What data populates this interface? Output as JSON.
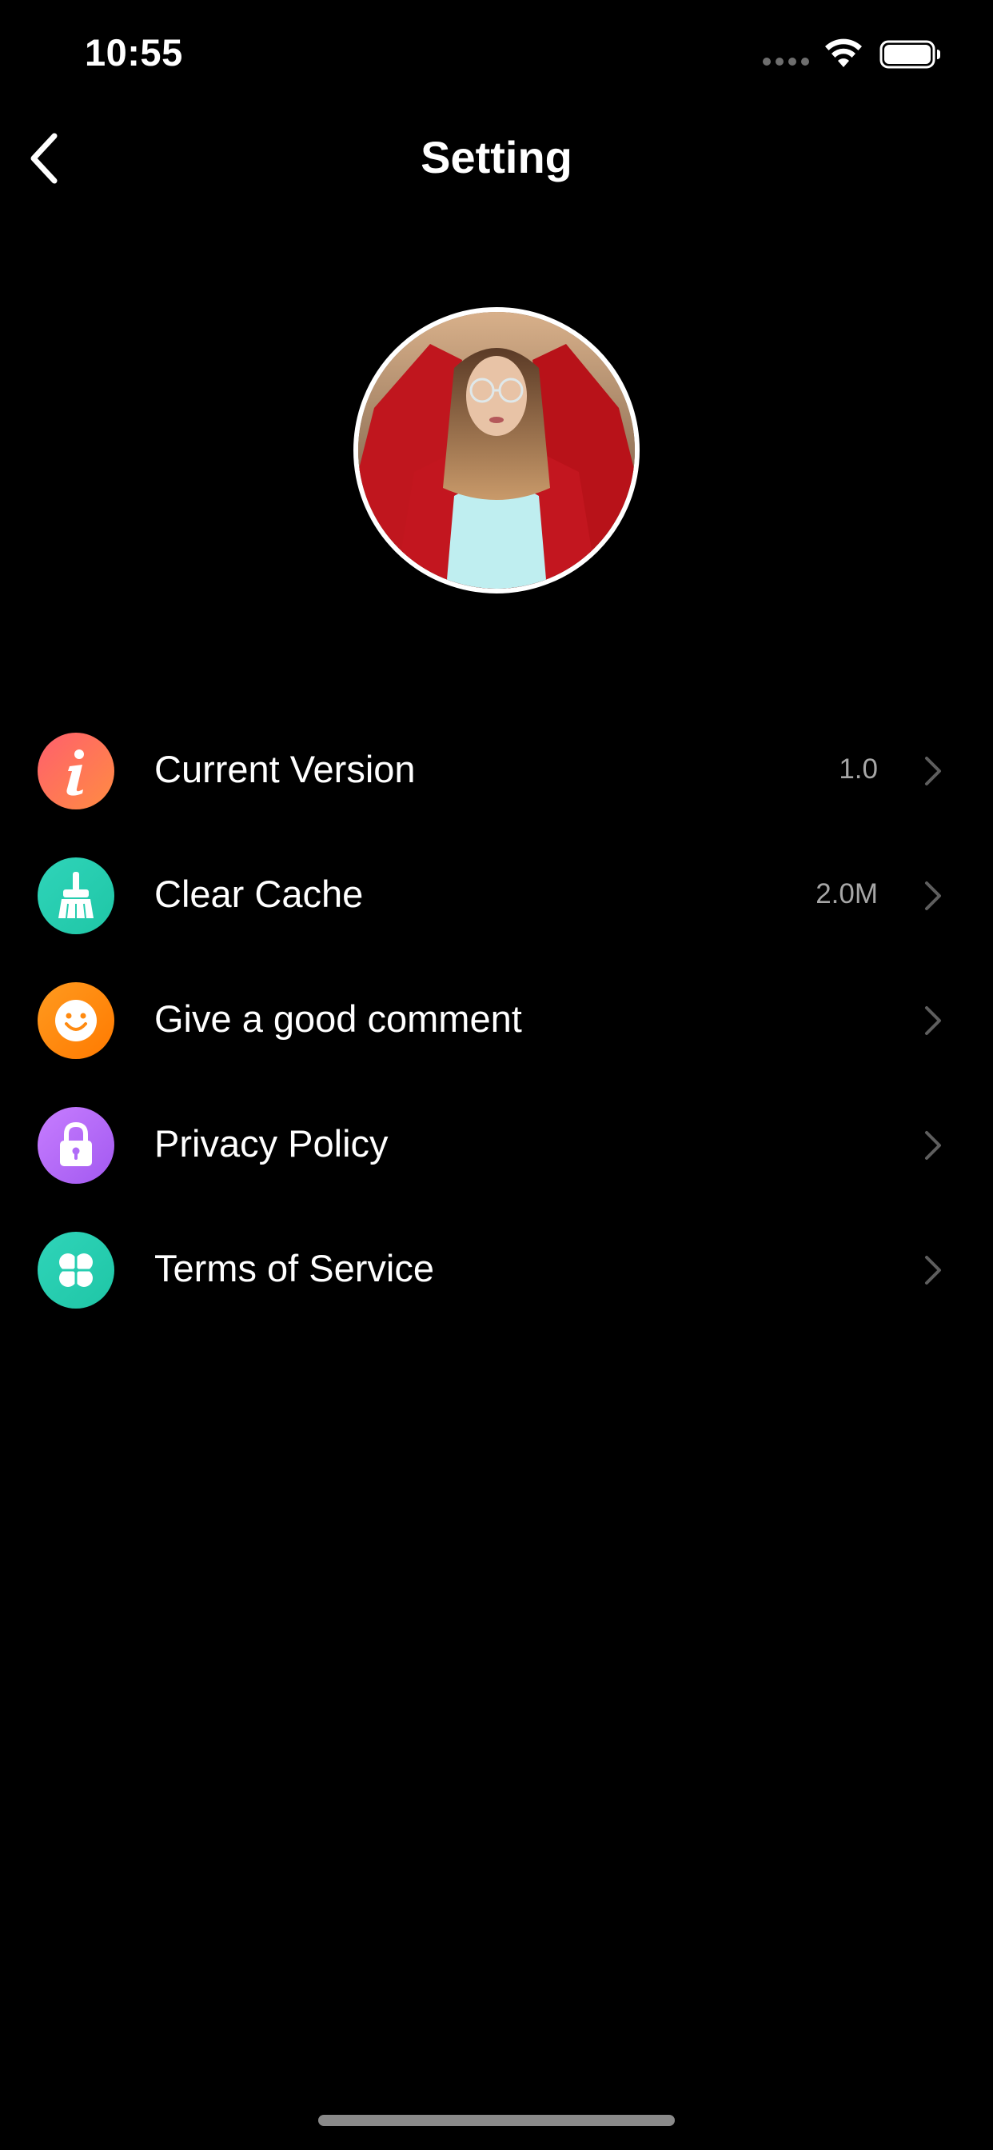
{
  "status_bar": {
    "time": "10:55"
  },
  "nav": {
    "title": "Setting"
  },
  "settings": {
    "items": [
      {
        "label": "Current Version",
        "value": "1.0",
        "icon": "info-icon",
        "color_from": "#ff5f6d",
        "color_to": "#ff8c42"
      },
      {
        "label": "Clear Cache",
        "value": "2.0M",
        "icon": "broom-icon",
        "color_from": "#2fd4b9",
        "color_to": "#1fc6a6"
      },
      {
        "label": "Give a good comment",
        "value": "",
        "icon": "smile-icon",
        "color_from": "#ff9a1f",
        "color_to": "#ff7a00"
      },
      {
        "label": "Privacy Policy",
        "value": "",
        "icon": "lock-icon",
        "color_from": "#c77dff",
        "color_to": "#a259f0"
      },
      {
        "label": "Terms of Service",
        "value": "",
        "icon": "clover-icon",
        "color_from": "#2fd4b9",
        "color_to": "#1fc6a6"
      }
    ]
  }
}
